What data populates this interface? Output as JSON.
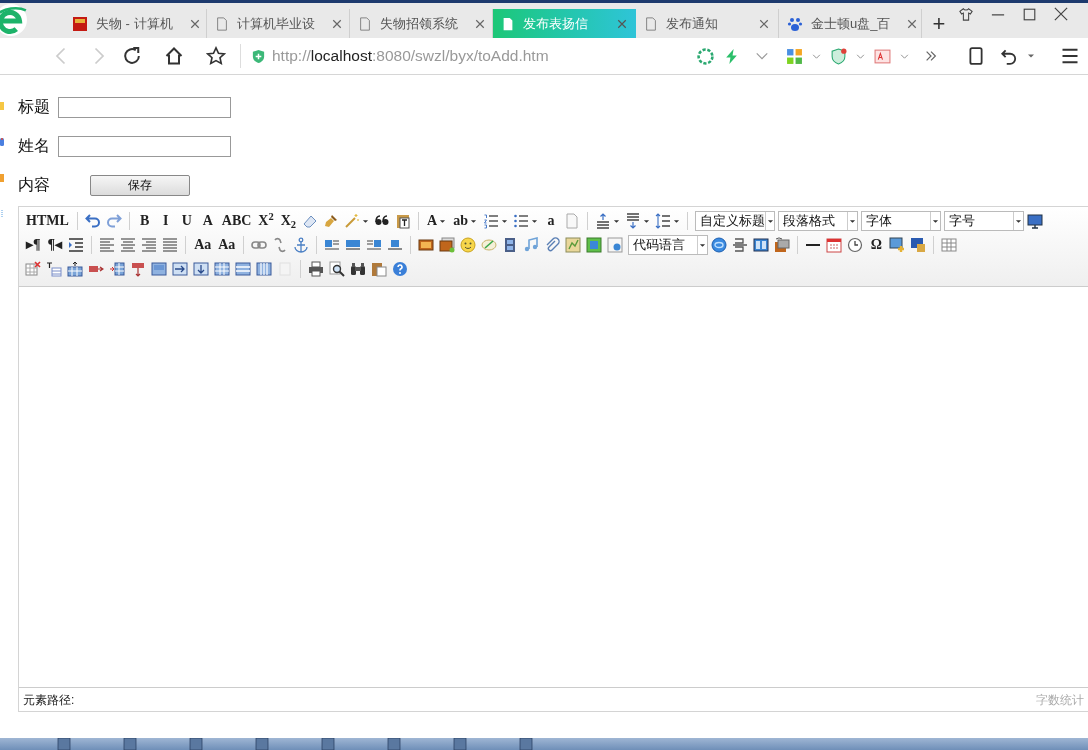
{
  "browser": {
    "tabs": [
      {
        "label": "失物 - 计算机",
        "selected": false
      },
      {
        "label": "计算机毕业设",
        "selected": false
      },
      {
        "label": "失物招领系统",
        "selected": false
      },
      {
        "label": "发布表扬信",
        "selected": true
      },
      {
        "label": "发布通知",
        "selected": false
      },
      {
        "label": "金士顿u盘_百",
        "selected": false
      }
    ],
    "new_tab": "+",
    "url": {
      "scheme": "http://",
      "host": "localhost",
      "path": ":8080/swzl/byx/toAdd.htm"
    }
  },
  "form": {
    "fields": [
      {
        "label": "标题"
      },
      {
        "label": "姓名"
      }
    ],
    "content_label": "内容",
    "save_button": "保存"
  },
  "editor": {
    "toolbar": [
      [
        {
          "kind": "text",
          "text": "HTML"
        },
        {
          "kind": "sep"
        },
        {
          "kind": "icon"
        },
        {
          "kind": "icon"
        },
        {
          "kind": "sep"
        },
        {
          "kind": "text",
          "text": "B"
        },
        {
          "kind": "text",
          "text": "I"
        },
        {
          "kind": "text",
          "text": "U"
        },
        {
          "kind": "text",
          "text": "A"
        },
        {
          "kind": "text",
          "text": "ABC"
        },
        {
          "kind": "text",
          "text": "X$^{2}$"
        },
        {
          "kind": "text",
          "text": "X$_{2}$"
        },
        {
          "kind": "icon"
        },
        {
          "kind": "icon"
        },
        {
          "kind": "icon_menu"
        },
        {
          "kind": "icon"
        },
        {
          "kind": "icon"
        },
        {
          "kind": "sep"
        },
        {
          "kind": "text_menu",
          "text": "A"
        },
        {
          "kind": "text_menu",
          "text": "ab"
        },
        {
          "kind": "icon_menu"
        },
        {
          "kind": "icon_menu"
        },
        {
          "kind": "text",
          "text": "a"
        },
        {
          "kind": "icon"
        },
        {
          "kind": "sep"
        },
        {
          "kind": "icon_menu"
        },
        {
          "kind": "icon_menu"
        },
        {
          "kind": "icon_menu"
        },
        {
          "kind": "sep"
        },
        {
          "kind": "select",
          "text": "自定义标题"
        },
        {
          "kind": "select",
          "text": "段落格式"
        },
        {
          "kind": "select",
          "text": "字体"
        },
        {
          "kind": "select",
          "text": "字号"
        },
        {
          "kind": "icon"
        }
      ],
      [
        {
          "kind": "text",
          "text": "▸¶"
        },
        {
          "kind": "text",
          "text": "¶◂"
        },
        {
          "kind": "icon"
        },
        {
          "kind": "sep"
        },
        {
          "kind": "icon"
        },
        {
          "kind": "icon"
        },
        {
          "kind": "icon"
        },
        {
          "kind": "icon"
        },
        {
          "kind": "sep"
        },
        {
          "kind": "text",
          "text": "Aa"
        },
        {
          "kind": "text",
          "text": "Aa"
        },
        {
          "kind": "sep"
        },
        {
          "kind": "icon"
        },
        {
          "kind": "icon"
        },
        {
          "kind": "icon"
        },
        {
          "kind": "sep"
        },
        {
          "kind": "icon"
        },
        {
          "kind": "icon"
        },
        {
          "kind": "icon"
        },
        {
          "kind": "icon"
        },
        {
          "kind": "sep"
        },
        {
          "kind": "icon"
        },
        {
          "kind": "icon"
        },
        {
          "kind": "icon"
        },
        {
          "kind": "icon"
        },
        {
          "kind": "icon"
        },
        {
          "kind": "icon"
        },
        {
          "kind": "icon"
        },
        {
          "kind": "icon"
        },
        {
          "kind": "icon"
        },
        {
          "kind": "icon"
        },
        {
          "kind": "select",
          "text": "代码语言"
        },
        {
          "kind": "icon"
        },
        {
          "kind": "icon"
        },
        {
          "kind": "icon"
        },
        {
          "kind": "icon"
        },
        {
          "kind": "sep"
        },
        {
          "kind": "icon"
        },
        {
          "kind": "icon"
        },
        {
          "kind": "icon"
        },
        {
          "kind": "text",
          "text": "Ω"
        },
        {
          "kind": "icon"
        },
        {
          "kind": "icon"
        },
        {
          "kind": "sep"
        },
        {
          "kind": "icon"
        }
      ],
      [
        {
          "kind": "icon"
        },
        {
          "kind": "icon"
        },
        {
          "kind": "icon"
        },
        {
          "kind": "icon"
        },
        {
          "kind": "icon"
        },
        {
          "kind": "icon"
        },
        {
          "kind": "icon"
        },
        {
          "kind": "icon"
        },
        {
          "kind": "icon"
        },
        {
          "kind": "icon"
        },
        {
          "kind": "icon"
        },
        {
          "kind": "icon"
        },
        {
          "kind": "icon"
        },
        {
          "kind": "sep"
        },
        {
          "kind": "icon"
        },
        {
          "kind": "icon"
        },
        {
          "kind": "icon"
        },
        {
          "kind": "icon"
        },
        {
          "kind": "icon"
        }
      ]
    ],
    "path_label": "元素路径:",
    "word_count": "字数统计"
  }
}
